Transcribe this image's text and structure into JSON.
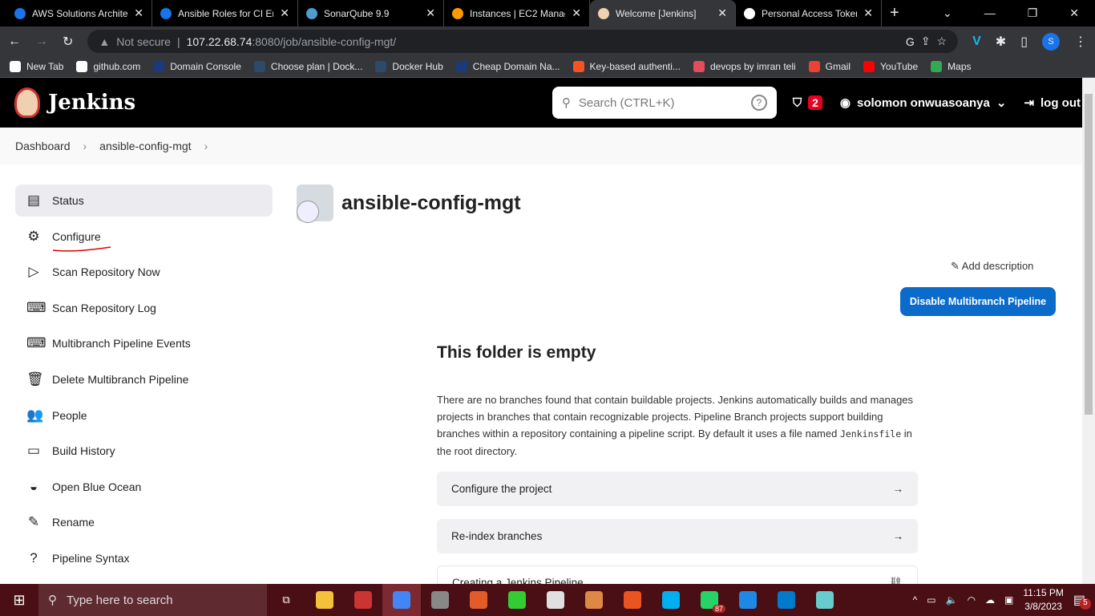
{
  "browser": {
    "tabs": [
      {
        "title": "AWS Solutions Archite",
        "color": "#1a73e8"
      },
      {
        "title": "Ansible Roles for CI En",
        "color": "#1a73e8"
      },
      {
        "title": "SonarQube 9.9",
        "color": "#4e9bcd"
      },
      {
        "title": "Instances | EC2 Manag",
        "color": "#f90"
      },
      {
        "title": "Welcome [Jenkins]",
        "color": "#f0d0b0"
      },
      {
        "title": "Personal Access Token",
        "color": "#fff"
      }
    ],
    "active_tab": 4,
    "security": "Not secure",
    "url_host": "107.22.68.74",
    "url_path": ":8080/job/ansible-config-mgt/",
    "profile": "S",
    "bookmarks": [
      {
        "label": "New Tab",
        "color": "#fff"
      },
      {
        "label": "github.com",
        "color": "#fff"
      },
      {
        "label": "Domain Console",
        "color": "#1b3a7a"
      },
      {
        "label": "Choose plan | Dock...",
        "color": "#2c4a6a"
      },
      {
        "label": "Docker Hub",
        "color": "#2c4a6a"
      },
      {
        "label": "Cheap Domain Na...",
        "color": "#1b3a7a"
      },
      {
        "label": "Key-based authenti...",
        "color": "#f35325"
      },
      {
        "label": "devops by imran teli",
        "color": "#e64a5d"
      },
      {
        "label": "Gmail",
        "color": "#ea4335"
      },
      {
        "label": "YouTube",
        "color": "#f00"
      },
      {
        "label": "Maps",
        "color": "#34a853"
      }
    ]
  },
  "jenkins": {
    "logo": "Jenkins",
    "search_placeholder": "Search (CTRL+K)",
    "security_count": "2",
    "user": "solomon onwuasoanya",
    "logout": "log out",
    "breadcrumb": [
      "Dashboard",
      "ansible-config-mgt"
    ],
    "sidebar": [
      {
        "label": "Status",
        "icon": "▤"
      },
      {
        "label": "Configure",
        "icon": "⚙"
      },
      {
        "label": "Scan Repository Now",
        "icon": "▷"
      },
      {
        "label": "Scan Repository Log",
        "icon": "⌨"
      },
      {
        "label": "Multibranch Pipeline Events",
        "icon": "⌨"
      },
      {
        "label": "Delete Multibranch Pipeline",
        "icon": "🗑"
      },
      {
        "label": "People",
        "icon": "👥"
      },
      {
        "label": "Build History",
        "icon": "▭"
      },
      {
        "label": "Open Blue Ocean",
        "icon": "◒"
      },
      {
        "label": "Rename",
        "icon": "✎"
      },
      {
        "label": "Pipeline Syntax",
        "icon": "?"
      }
    ],
    "title": "ansible-config-mgt",
    "add_description": "Add description",
    "disable_button": "Disable Multibranch Pipeline",
    "empty_title": "This folder is empty",
    "empty_text": "There are no branches found that contain buildable projects. Jenkins automatically builds and manages projects in branches that contain recognizable projects. Pipeline Branch projects support building branches within a repository containing a pipeline script. By default it uses a file named ",
    "empty_code": "Jenkinsfile",
    "empty_tail": " in the root directory.",
    "actions": [
      "Configure the project",
      "Re-index branches",
      "Creating a Jenkins Pipeline"
    ]
  },
  "taskbar": {
    "search": "Type here to search",
    "time": "11:15 PM",
    "date": "3/8/2023",
    "notifications": "5",
    "whatsapp_badge": "87",
    "apps": [
      "#f3c13a",
      "#c33",
      "#4285f4",
      "#888",
      "#e25b2b",
      "#3c3",
      "#e0e0e0",
      "#d84",
      "#e95420",
      "#00aff0",
      "#25d366",
      "#1e88e5",
      "#007acc",
      "#6cc"
    ]
  }
}
